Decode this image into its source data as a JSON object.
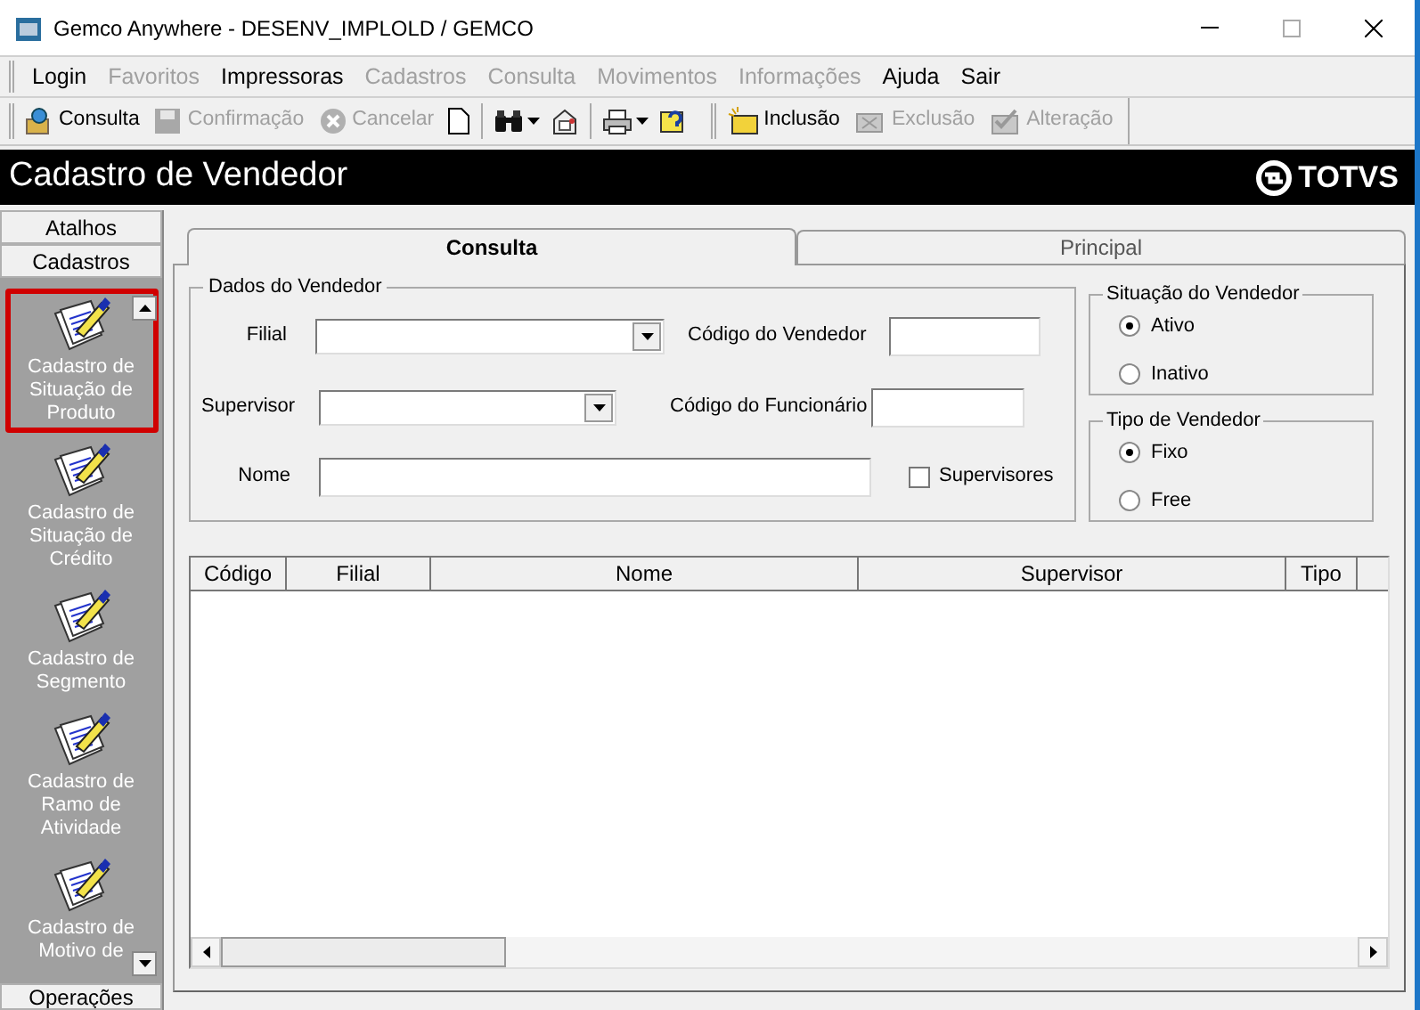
{
  "window": {
    "title": "Gemco Anywhere - DESENV_IMPLOLD / GEMCO"
  },
  "menu": [
    {
      "label": "Login",
      "disabled": false
    },
    {
      "label": "Favoritos",
      "disabled": true
    },
    {
      "label": "Impressoras",
      "disabled": false
    },
    {
      "label": "Cadastros",
      "disabled": true
    },
    {
      "label": "Consulta",
      "disabled": true
    },
    {
      "label": "Movimentos",
      "disabled": true
    },
    {
      "label": "Informações",
      "disabled": true
    },
    {
      "label": "Ajuda",
      "disabled": false
    },
    {
      "label": "Sair",
      "disabled": false
    }
  ],
  "toolbar": [
    {
      "kind": "labeled",
      "label": "Consulta",
      "disabled": false
    },
    {
      "kind": "labeled",
      "label": "Confirmação",
      "disabled": true
    },
    {
      "kind": "labeled",
      "label": "Cancelar",
      "disabled": true
    },
    {
      "kind": "icon",
      "disabled": false
    },
    {
      "kind": "separator"
    },
    {
      "kind": "dropdown",
      "disabled": false
    },
    {
      "kind": "icon",
      "disabled": false
    },
    {
      "kind": "separator"
    },
    {
      "kind": "dropdown",
      "disabled": false
    },
    {
      "kind": "icon",
      "disabled": false
    },
    {
      "kind": "gap"
    },
    {
      "kind": "labeled",
      "label": "Inclusão",
      "disabled": false
    },
    {
      "kind": "labeled",
      "label": "Exclusão",
      "disabled": true
    },
    {
      "kind": "labeled",
      "label": "Alteração",
      "disabled": true
    }
  ],
  "header": {
    "title": "Cadastro de Vendedor",
    "logo": "TOTVS"
  },
  "sidebar": {
    "sections": [
      {
        "label": "Atalhos"
      },
      {
        "label": "Cadastros"
      }
    ],
    "items": [
      {
        "label": "Cadastro de Situação de Produto",
        "selected": true
      },
      {
        "label": "Cadastro de Situação de Crédito",
        "selected": false
      },
      {
        "label": "Cadastro de Segmento",
        "selected": false
      },
      {
        "label": "Cadastro de Ramo de Atividade",
        "selected": false
      },
      {
        "label": "Cadastro de Motivo de",
        "selected": false
      }
    ],
    "bottom_section": {
      "label": "Operações"
    }
  },
  "tabs": [
    {
      "label": "Consulta",
      "selected": true
    },
    {
      "label": "Principal",
      "selected": false
    }
  ],
  "dados": {
    "title": "Dados do Vendedor",
    "filial": {
      "label": "Filial"
    },
    "codigo_vendedor": {
      "label": "Código do Vendedor"
    },
    "supervisor": {
      "label": "Supervisor"
    },
    "codigo_funcionario": {
      "label": "Código do Funcionário"
    },
    "nome": {
      "label": "Nome"
    },
    "supervisores": {
      "label": "Supervisores",
      "checked": false
    }
  },
  "situacao": {
    "title": "Situação do Vendedor",
    "options": [
      {
        "label": "Ativo",
        "selected": true
      },
      {
        "label": "Inativo",
        "selected": false
      }
    ]
  },
  "tipo": {
    "title": "Tipo de Vendedor",
    "options": [
      {
        "label": "Fixo",
        "selected": true
      },
      {
        "label": "Free",
        "selected": false
      }
    ]
  },
  "table": {
    "columns": [
      "Código",
      "Filial",
      "Nome",
      "Supervisor",
      "Tipo"
    ]
  }
}
